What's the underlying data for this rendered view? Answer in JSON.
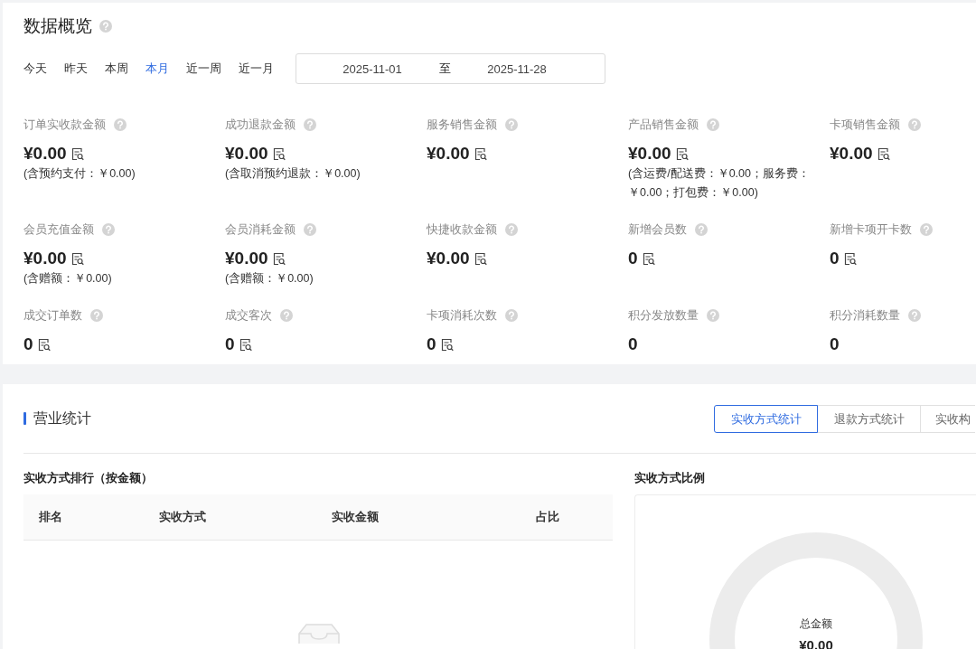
{
  "overview": {
    "title": "数据概览",
    "ranges": [
      {
        "label": "今天",
        "selected": false
      },
      {
        "label": "昨天",
        "selected": false
      },
      {
        "label": "本周",
        "selected": false
      },
      {
        "label": "本月",
        "selected": true
      },
      {
        "label": "近一周",
        "selected": false
      },
      {
        "label": "近一月",
        "selected": false
      }
    ],
    "date_range": {
      "start": "2025-11-01",
      "separator": "至",
      "end": "2025-11-28"
    },
    "metrics": [
      {
        "label": "订单实收款金额",
        "value": "¥0.00",
        "detail_icon": true,
        "note": "(含预约支付：￥0.00)"
      },
      {
        "label": "成功退款金额",
        "value": "¥0.00",
        "detail_icon": true,
        "note": "(含取消预约退款：￥0.00)"
      },
      {
        "label": "服务销售金额",
        "value": "¥0.00",
        "detail_icon": true
      },
      {
        "label": "产品销售金额",
        "value": "¥0.00",
        "detail_icon": true,
        "note": "(含运费/配送费：￥0.00；服务费：￥0.00；打包费：￥0.00)"
      },
      {
        "label": "卡项销售金额",
        "value": "¥0.00",
        "detail_icon": true
      },
      {
        "label": "会员充值金额",
        "value": "¥0.00",
        "detail_icon": true,
        "note": "(含赠额：￥0.00)"
      },
      {
        "label": "会员消耗金额",
        "value": "¥0.00",
        "detail_icon": true,
        "note": "(含赠额：￥0.00)"
      },
      {
        "label": "快捷收款金额",
        "value": "¥0.00",
        "detail_icon": true
      },
      {
        "label": "新增会员数",
        "value": "0",
        "detail_icon": true
      },
      {
        "label": "新增卡项开卡数",
        "value": "0",
        "detail_icon": true
      },
      {
        "label": "成交订单数",
        "value": "0",
        "detail_icon": true
      },
      {
        "label": "成交客次",
        "value": "0",
        "detail_icon": true
      },
      {
        "label": "卡项消耗次数",
        "value": "0",
        "detail_icon": true
      },
      {
        "label": "积分发放数量",
        "value": "0",
        "detail_icon": false
      },
      {
        "label": "积分消耗数量",
        "value": "0",
        "detail_icon": false
      }
    ]
  },
  "business": {
    "title": "营业统计",
    "tabs": [
      {
        "label": "实收方式统计",
        "selected": true
      },
      {
        "label": "退款方式统计",
        "selected": false
      },
      {
        "label": "实收构",
        "selected": false
      }
    ],
    "ranking": {
      "title": "实收方式排行（按金额）",
      "columns": [
        "排名",
        "实收方式",
        "实收金额",
        "占比"
      ]
    },
    "ratio": {
      "title": "实收方式比例",
      "center_label": "总金额",
      "center_value": "¥0.00"
    }
  }
}
